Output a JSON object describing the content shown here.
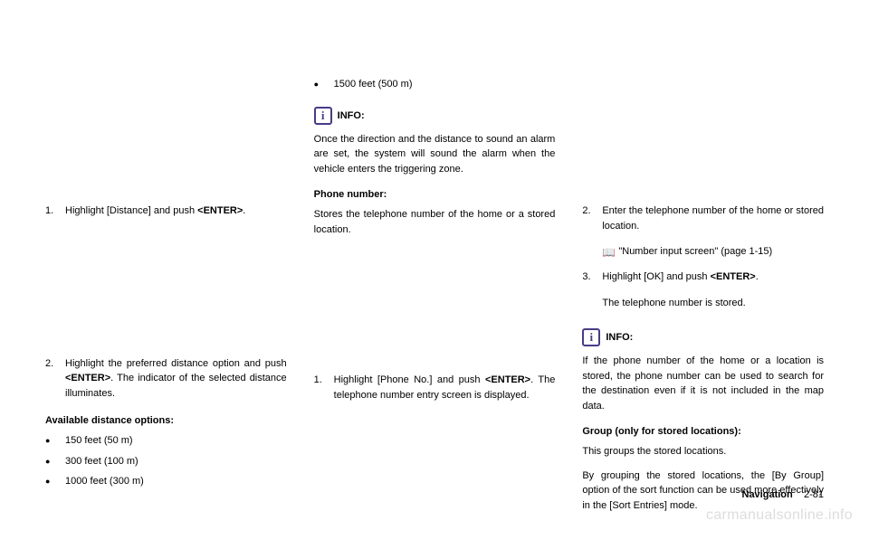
{
  "col1": {
    "step1_num": "1.",
    "step1_text": "Highlight [Distance] and push ",
    "step1_enter": "<ENTER>",
    "step1_tail": ".",
    "step2_num": "2.",
    "step2_text": "Highlight the preferred distance option and push ",
    "step2_enter": "<ENTER>",
    "step2_tail": ". The indicator of the selected distance illuminates.",
    "avail_heading": "Available distance options:",
    "opt1": "150 feet (50 m)",
    "opt2": "300 feet (100 m)",
    "opt3": "1000 feet (300 m)"
  },
  "col2": {
    "opt4": "1500 feet (500 m)",
    "info_label": "INFO:",
    "info_text": "Once the direction and the distance to sound an alarm are set, the system will sound the alarm when the vehicle enters the triggering zone.",
    "phone_heading": "Phone number:",
    "phone_text": "Stores the telephone number of the home or a stored location.",
    "step1_num": "1.",
    "step1_text": "Highlight [Phone No.] and push ",
    "step1_enter": "<ENTER>",
    "step1_tail": ". The telephone number entry screen is displayed."
  },
  "col3": {
    "step2_num": "2.",
    "step2_text": "Enter the telephone number of the home or stored location.",
    "ref_text": "\"Number input screen\" (page 1-15)",
    "step3_num": "3.",
    "step3_text": "Highlight [OK] and push ",
    "step3_enter": "<ENTER>",
    "step3_tail": ".",
    "step3_result": "The telephone number is stored.",
    "info_label": "INFO:",
    "info_text": "If the phone number of the home or a location is stored, the phone number can be used to search for the destination even if it is not included in the map data.",
    "group_heading": "Group (only for stored locations):",
    "group_text1": "This groups the stored locations.",
    "group_text2": "By grouping the stored locations, the [By Group] option of the sort function can be used more effectively in the [Sort Entries] mode."
  },
  "footer": {
    "nav": "Navigation",
    "page": "2-81"
  },
  "watermark": "carmanualsonline.info",
  "icons": {
    "info_glyph": "i",
    "book_glyph": "📖",
    "bullet_glyph": "●"
  }
}
